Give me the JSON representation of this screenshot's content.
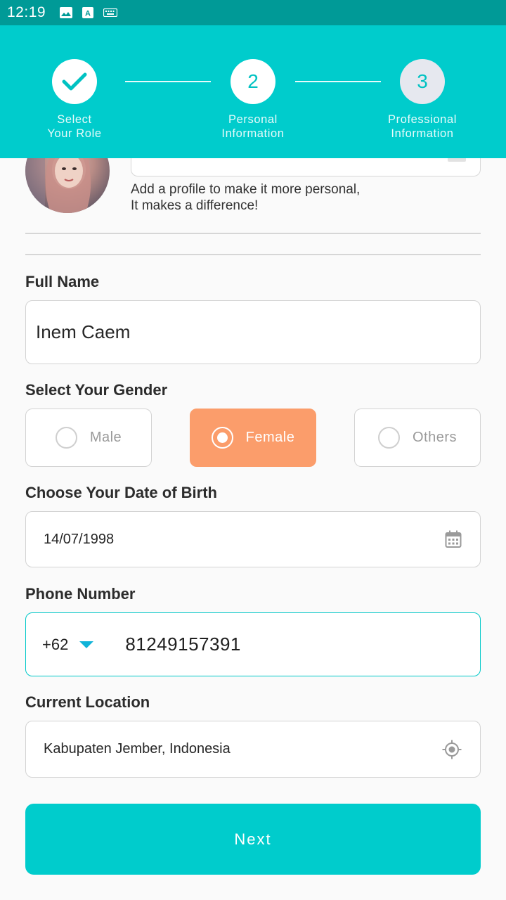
{
  "status_bar": {
    "time": "12:19",
    "icons": [
      "image-icon",
      "a-box-icon",
      "keyboard-icon"
    ]
  },
  "stepper": {
    "steps": [
      {
        "number": "",
        "label_line1": "Select",
        "label_line2": "Your Role",
        "state": "done"
      },
      {
        "number": "2",
        "label_line1": "Personal",
        "label_line2": "Information",
        "state": "active"
      },
      {
        "number": "3",
        "label_line1": "Professional",
        "label_line2": "Information",
        "state": "pending"
      }
    ]
  },
  "profile": {
    "hint_line1": "Add a profile to make it more personal,",
    "hint_line2": "It makes a difference!"
  },
  "full_name": {
    "label": "Full Name",
    "value": "Inem Caem"
  },
  "gender": {
    "label": "Select Your Gender",
    "options": [
      "Male",
      "Female",
      "Others"
    ],
    "selected": "Female"
  },
  "dob": {
    "label": "Choose Your Date of Birth",
    "value": "14/07/1998"
  },
  "phone": {
    "label": "Phone Number",
    "country_code": "+62",
    "value": "81249157391"
  },
  "location": {
    "label": "Current Location",
    "value": "Kabupaten Jember, Indonesia"
  },
  "next_button": {
    "label": "Next"
  },
  "colors": {
    "primary": "#00cccc",
    "status_bar": "#009a97",
    "selected_option": "#fb9d6b",
    "accent_caret": "#10b3d8"
  }
}
